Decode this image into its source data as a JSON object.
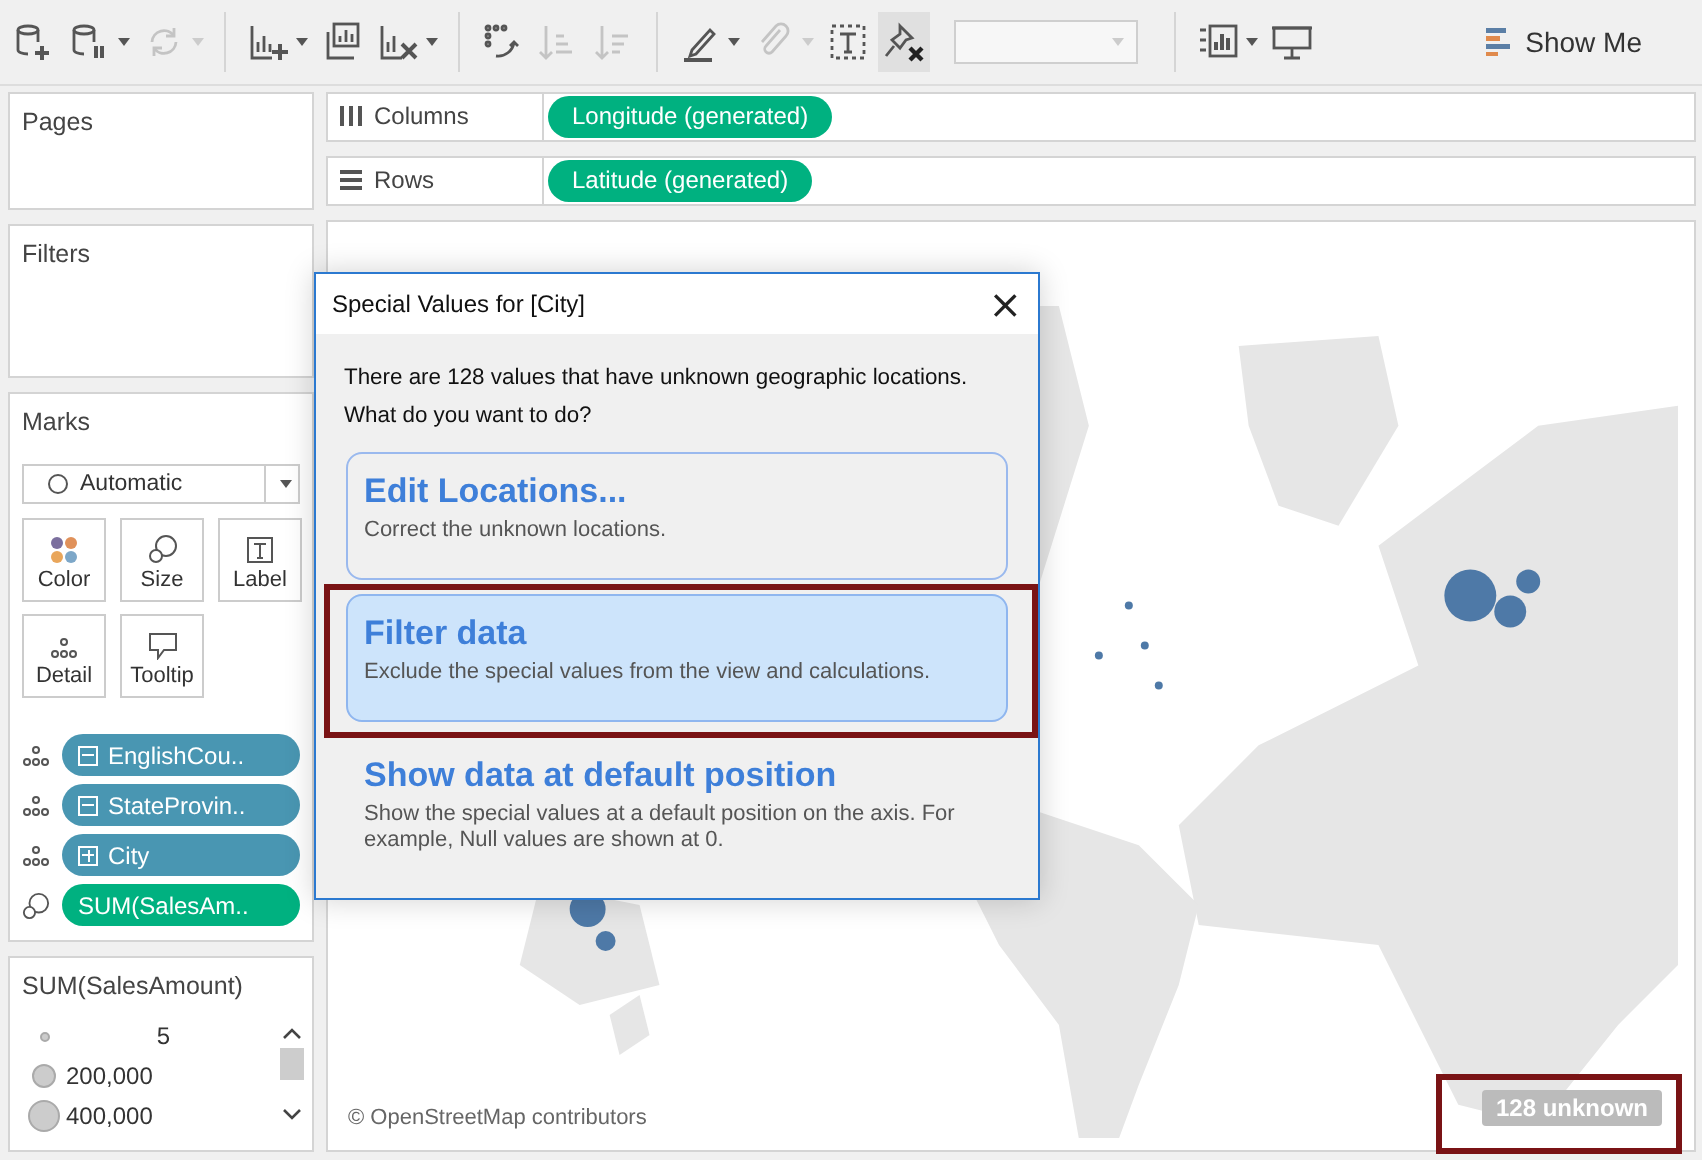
{
  "toolbar": {
    "buttons": [
      {
        "kind": "new-datasource",
        "disabled": false,
        "dropdown": false
      },
      {
        "kind": "pause",
        "disabled": false,
        "dropdown": true
      },
      {
        "kind": "refresh",
        "disabled": true,
        "dropdown": true
      },
      {
        "kind": "new-sheet",
        "disabled": false,
        "dropdown": true
      },
      {
        "kind": "duplicate",
        "disabled": false,
        "dropdown": false
      },
      {
        "kind": "clear",
        "disabled": false,
        "dropdown": true
      },
      {
        "kind": "swap",
        "disabled": false,
        "dropdown": false
      },
      {
        "kind": "sort-asc",
        "disabled": true,
        "dropdown": false
      },
      {
        "kind": "sort-desc",
        "disabled": true,
        "dropdown": false
      },
      {
        "kind": "highlight",
        "disabled": false,
        "dropdown": true
      },
      {
        "kind": "attach",
        "disabled": true,
        "dropdown": true
      },
      {
        "kind": "textbox",
        "disabled": false,
        "dropdown": false
      },
      {
        "kind": "pin",
        "disabled": false,
        "dropdown": false,
        "selected": true
      },
      {
        "kind": "fit-field",
        "disabled": true,
        "dropdown": true
      },
      {
        "kind": "labels",
        "disabled": false,
        "dropdown": true
      },
      {
        "kind": "presentation",
        "disabled": false,
        "dropdown": false
      }
    ],
    "show_me": "Show Me"
  },
  "pages": {
    "title": "Pages"
  },
  "filters": {
    "title": "Filters"
  },
  "marks": {
    "title": "Marks",
    "mark_type": "Automatic",
    "cards": [
      {
        "kind": "color",
        "label": "Color"
      },
      {
        "kind": "size",
        "label": "Size"
      },
      {
        "kind": "label",
        "label": "Label"
      },
      {
        "kind": "detail",
        "label": "Detail"
      },
      {
        "kind": "tooltip",
        "label": "Tooltip"
      }
    ],
    "pills": [
      {
        "kind": "detail-collapse",
        "label": "EnglishCou..",
        "color": "#4996b2"
      },
      {
        "kind": "detail-collapse",
        "label": "StateProvin..",
        "color": "#4996b2"
      },
      {
        "kind": "detail-expand",
        "label": "City",
        "color": "#4996b2"
      },
      {
        "kind": "size",
        "label": "SUM(SalesAm..",
        "color": "#00b180"
      }
    ]
  },
  "legend": {
    "title": "SUM(SalesAmount)",
    "items": [
      {
        "label": "5"
      },
      {
        "label": "200,000"
      },
      {
        "label": "400,000"
      }
    ]
  },
  "shelves": [
    {
      "kind": "columns",
      "label": "Columns",
      "pill": "Longitude (generated)"
    },
    {
      "kind": "rows",
      "label": "Rows",
      "pill": "Latitude (generated)"
    }
  ],
  "dialog": {
    "title": "Special Values for [City]",
    "close": "×",
    "message": [
      "There are 128 values that have unknown geographic locations.",
      "What do you want to do?"
    ],
    "options": [
      {
        "title": "Edit Locations...",
        "description": "Correct the unknown locations.",
        "selected": false,
        "default": true
      },
      {
        "title": "Filter data",
        "description": "Exclude the special values from the view and calculations.",
        "selected": true,
        "default": false
      },
      {
        "title": "Show data at default position",
        "description": "Show the special values at a default position on the axis. For example, Null values are shown at 0.",
        "selected": false,
        "default": false
      }
    ]
  },
  "map": {
    "attribution": "© OpenStreetMap contributors",
    "unknown_badge": "128 unknown"
  }
}
